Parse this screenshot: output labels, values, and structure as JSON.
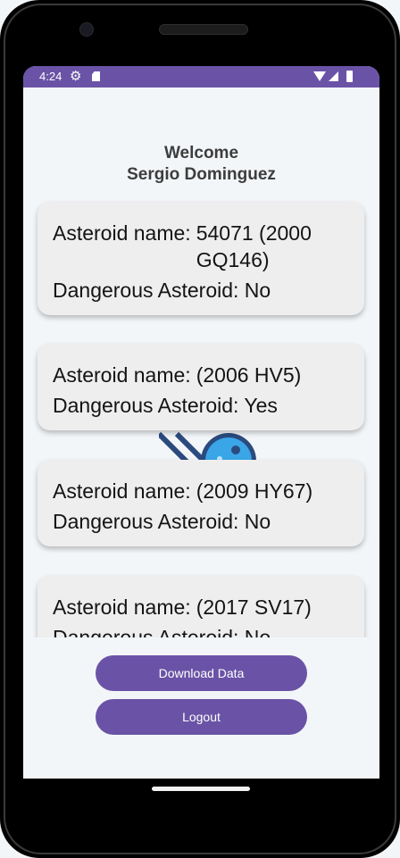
{
  "status_bar": {
    "time": "4:24",
    "icons": [
      "settings-icon",
      "sd-card-icon",
      "wifi-icon",
      "signal-icon",
      "battery-icon"
    ]
  },
  "header": {
    "line1": "Welcome",
    "line2": "Sergio Dominguez"
  },
  "labels": {
    "asteroid_name": "Asteroid name:",
    "dangerous": "Dangerous Asteroid:"
  },
  "asteroids": [
    {
      "name": "54071 (2000 GQ146)",
      "dangerous": "No"
    },
    {
      "name": "(2006 HV5)",
      "dangerous": "Yes"
    },
    {
      "name": "(2009 HY67)",
      "dangerous": "No"
    },
    {
      "name": "(2017 SV17)",
      "dangerous": "No"
    }
  ],
  "buttons": {
    "download": "Download Data",
    "logout": "Logout"
  },
  "colors": {
    "primary": "#6a53a6",
    "card": "#eeeeee",
    "background": "#f3f6f9"
  }
}
